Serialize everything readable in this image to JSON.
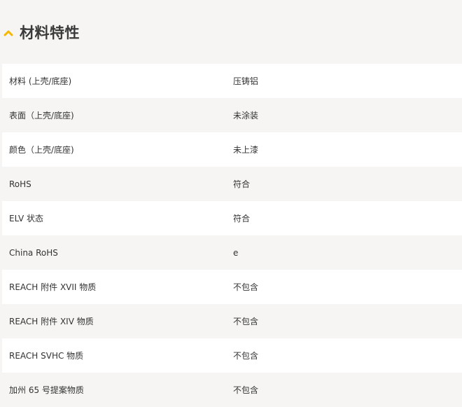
{
  "section": {
    "title": "材料特性",
    "accent_color": "#f5b800",
    "chevron_icon": "chevron-up-icon"
  },
  "properties": [
    {
      "name": "材料 (上壳/底座)",
      "value": "压铸铝"
    },
    {
      "name": "表面（上壳/底座)",
      "value": "未涂装"
    },
    {
      "name": "颜色（上壳/底座)",
      "value": "未上漆"
    },
    {
      "name": "RoHS",
      "value": "符合"
    },
    {
      "name": "ELV 状态",
      "value": "符合"
    },
    {
      "name": "China RoHS",
      "value": "e"
    },
    {
      "name": "REACH 附件 XVII 物质",
      "value": "不包含"
    },
    {
      "name": "REACH 附件 XIV 物质",
      "value": "不包含"
    },
    {
      "name": "REACH SVHC 物质",
      "value": "不包含"
    },
    {
      "name": "加州 65 号提案物质",
      "value": "不包含"
    }
  ]
}
